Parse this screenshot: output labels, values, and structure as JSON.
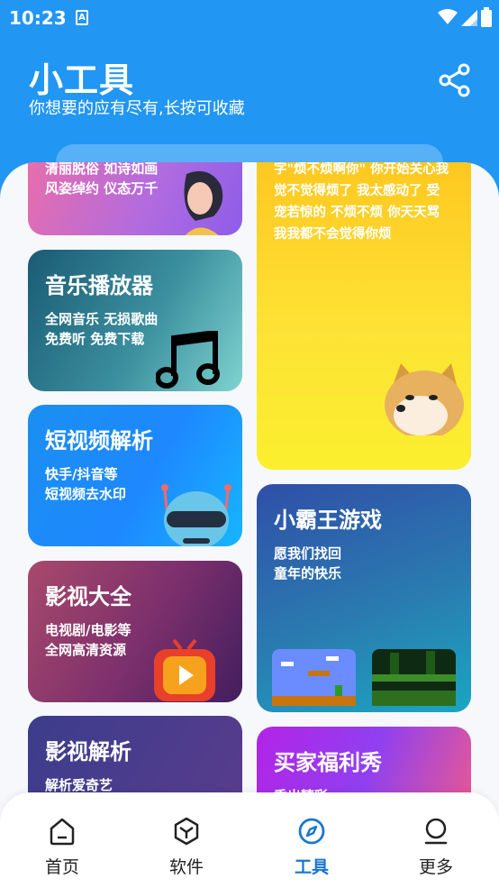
{
  "status": {
    "time": "10:23",
    "badge": "A"
  },
  "header": {
    "title": "小工具",
    "subtitle": "你想要的应有尽有,长按可收藏"
  },
  "cards": {
    "top_left": {
      "desc": "清丽脱俗 如诗如画\n风姿绰约 仪态万千"
    },
    "music": {
      "title": "音乐播放器",
      "desc": "全网音乐 无损歌曲\n免费听 免费下载"
    },
    "video_parse": {
      "title": "短视频解析",
      "desc": "快手/抖音等\n短视频去水印"
    },
    "movies": {
      "title": "影视大全",
      "desc": "电视剧/电影等\n全网高清资源"
    },
    "movie_parse": {
      "title": "影视解析",
      "desc": "解析爱奇艺"
    },
    "right_top": {
      "desc": "字\"烦不烦啊你\" 你开始关心我\n觉不觉得烦了 我太感动了 受\n宠若惊的 不烦不烦 你天天骂\n我我都不会觉得你烦"
    },
    "games": {
      "title": "小霸王游戏",
      "desc": "愿我们找回\n童年的快乐"
    },
    "buyer": {
      "title": "买家福利秀",
      "desc": "秀出精彩"
    }
  },
  "nav": {
    "items": [
      {
        "label": "首页",
        "icon": "home-icon"
      },
      {
        "label": "软件",
        "icon": "cube-icon"
      },
      {
        "label": "工具",
        "icon": "compass-icon"
      },
      {
        "label": "更多",
        "icon": "profile-icon"
      }
    ],
    "active_color": "#1976d2"
  },
  "colors": {
    "header": "#2196f3",
    "active": "#1976d2"
  }
}
